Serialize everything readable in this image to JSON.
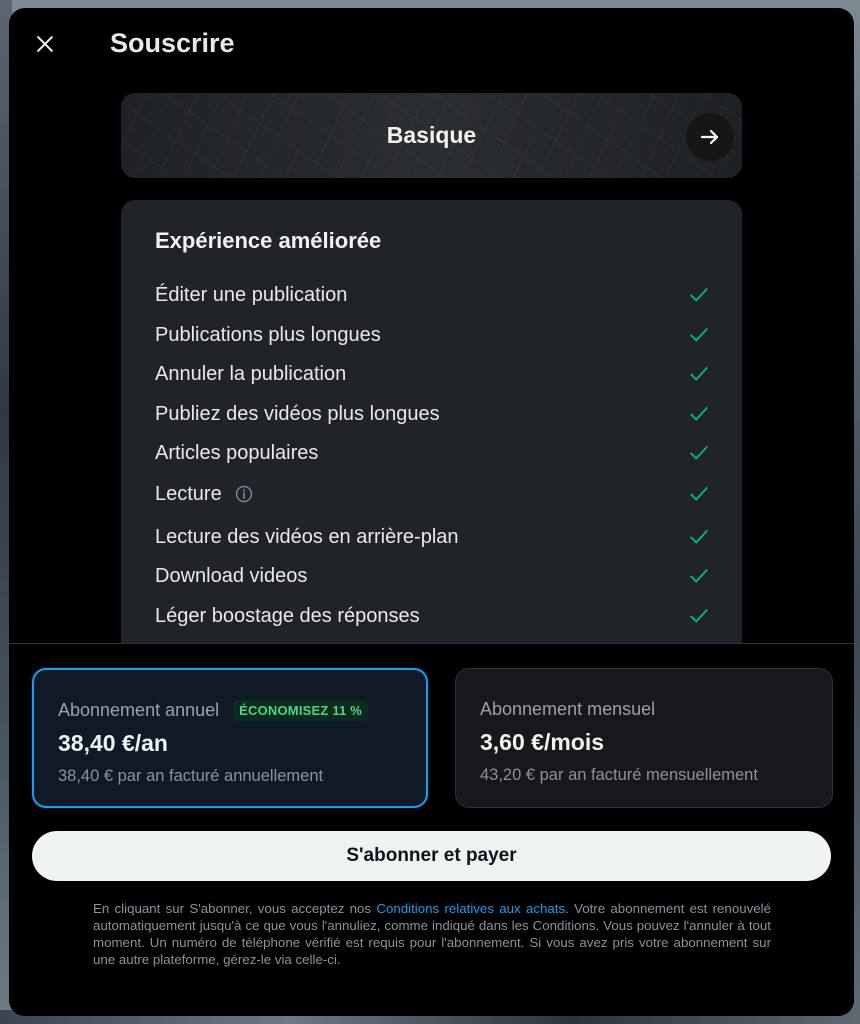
{
  "dialog": {
    "title": "Souscrire",
    "close_icon": "close-icon"
  },
  "plan": {
    "name": "Basique",
    "next_icon": "arrow-right-icon"
  },
  "features": {
    "title": "Expérience améliorée",
    "items": [
      {
        "label": "Éditer une publication",
        "included": true
      },
      {
        "label": "Publications plus longues",
        "included": true
      },
      {
        "label": "Annuler la publication",
        "included": true
      },
      {
        "label": "Publiez des vidéos plus longues",
        "included": true
      },
      {
        "label": "Articles populaires",
        "included": true
      },
      {
        "label": "Lecture",
        "included": true,
        "info_icon": "info-icon"
      },
      {
        "label": "Lecture des vidéos en arrière-plan",
        "included": true
      },
      {
        "label": "Download videos",
        "included": true
      },
      {
        "label": "Léger boostage des réponses",
        "included": true
      }
    ]
  },
  "billing": {
    "annual": {
      "label": "Abonnement annuel",
      "badge": "ÉCONOMISEZ 11 %",
      "price": "38,40 €/an",
      "sub": "38,40 € par an facturé annuellement",
      "selected": true
    },
    "monthly": {
      "label": "Abonnement mensuel",
      "price": "3,60 €/mois",
      "sub": "43,20 € par an facturé mensuellement",
      "selected": false
    }
  },
  "subscribe": {
    "label": "S'abonner et payer"
  },
  "legal": {
    "before_link": "En cliquant sur S'abonner, vous acceptez nos ",
    "link": "Conditions relatives aux achats",
    "after_link": ". Votre abonnement est renouvelé automatiquement jusqu'à ce que vous l'annuliez, comme indiqué dans les Conditions. Vous pouvez l'annuler à tout moment. Un numéro de téléphone vérifié est requis pour l'abonnement. Si vous avez pris votre abonnement sur une autre plateforme, gérez-le via celle-ci."
  },
  "colors": {
    "accent": "#1d9bf0",
    "check": "#00ba7c",
    "badge_text": "#4ad58a"
  }
}
